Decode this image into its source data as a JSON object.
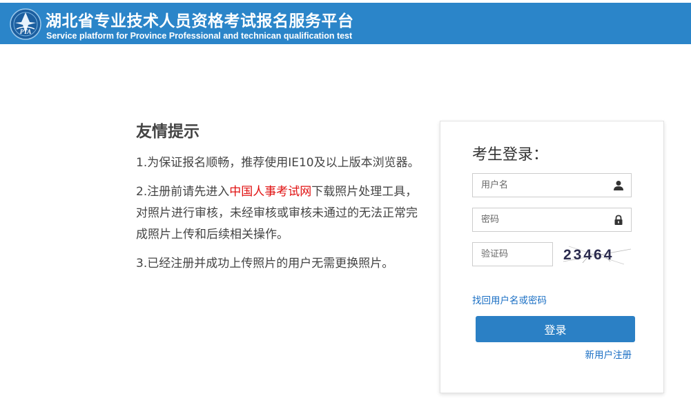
{
  "header": {
    "title_cn": "湖北省专业技术人员资格考试报名服务平台",
    "title_en": "Service platform for Province Professional and technican qualification test",
    "logo_text": "PTA",
    "background": "#2b85c9"
  },
  "tips": {
    "title": "友情提示",
    "item1": "1.为保证报名顺畅，推荐使用IE10及以上版本浏览器。",
    "item2_before": "2.注册前请先进入",
    "item2_link": "中国人事考试网",
    "item2_after": "下载照片处理工具，对照片进行审核，未经审核或审核未通过的无法正常完成照片上传和后续相关操作。",
    "item3": "3.已经注册并成功上传照片的用户无需更换照片。"
  },
  "login": {
    "title": "考生登录：",
    "username_placeholder": "用户名",
    "password_placeholder": "密码",
    "captcha_placeholder": "验证码",
    "captcha_text": "23464",
    "forgot_link": "找回用户名或密码",
    "login_button": "登录",
    "register_link": "新用户注册",
    "icons": {
      "username": "user-icon",
      "password": "lock-icon"
    }
  },
  "colors": {
    "accent": "#2b80c5",
    "link": "#1a6fc4",
    "highlight_link": "#e01010"
  }
}
